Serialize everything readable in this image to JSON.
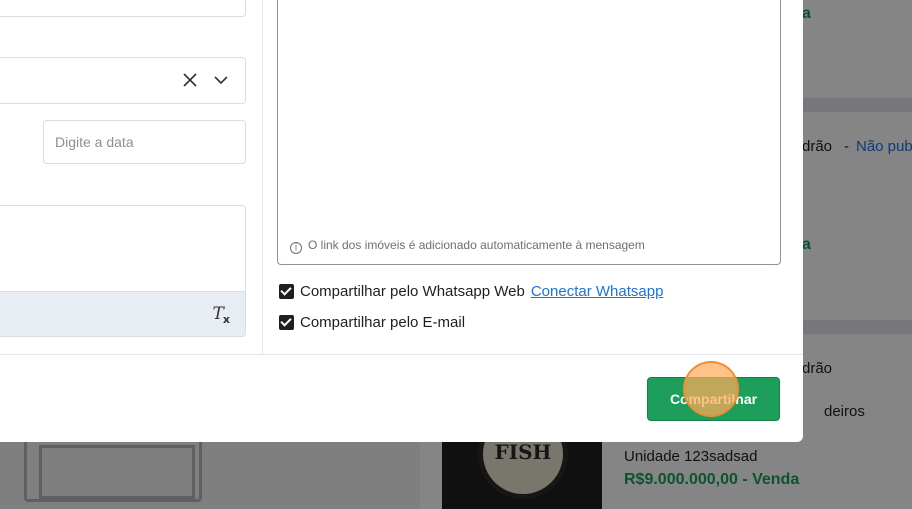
{
  "background": {
    "card1_price_suffix": "a",
    "card2_title_fragment": "drão",
    "card2_dash": "-",
    "card2_status": "Não pub",
    "card2_price_suffix": "a",
    "card3_title_fragment": "drão",
    "card3_detail_fragment": "deiros",
    "card3_unit": "Unidade 123sadsad",
    "card3_price": "R$9.000.000,00 - Venda",
    "thumbnail_logo": "FISH"
  },
  "form": {
    "date_placeholder": "Digite a data"
  },
  "message": {
    "hint": "O link dos imóveis é adicionado automaticamente à mensagem"
  },
  "options": {
    "whatsapp_label": "Compartilhar pelo Whatsapp Web",
    "whatsapp_connect": "Conectar Whatsapp",
    "email_label": "Compartilhar pelo E-mail"
  },
  "footer": {
    "share_label": "Compartilhar"
  },
  "icons": {
    "clear": "close-icon",
    "dropdown": "chevron-down-icon",
    "clear_format": "clear-format-icon",
    "info": "info-icon"
  },
  "colors": {
    "primary_green": "#1e9e5b",
    "link_blue": "#1a73e8",
    "price_green": "#1aa05a"
  }
}
